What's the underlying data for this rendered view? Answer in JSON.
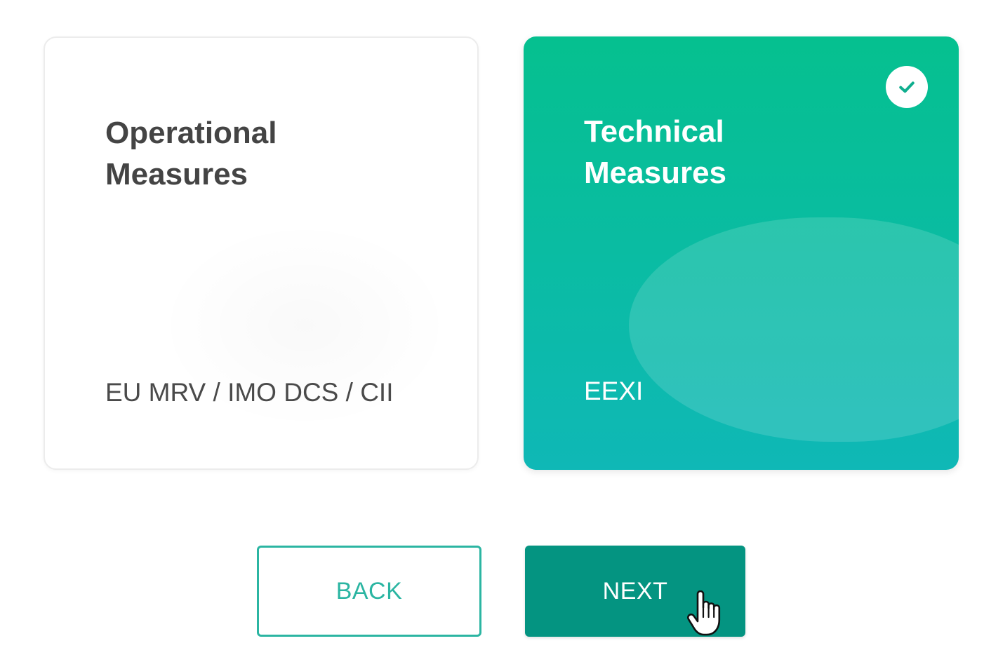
{
  "cards": [
    {
      "title_line1": "Operational",
      "title_line2": "Measures",
      "subtitle": "EU MRV / IMO DCS / CII",
      "selected": false
    },
    {
      "title_line1": "Technical",
      "title_line2": "Measures",
      "subtitle": "EEXI",
      "selected": true
    }
  ],
  "buttons": {
    "back_label": "BACK",
    "next_label": "NEXT"
  },
  "colors": {
    "accent": "#049481",
    "selected_gradient_top": "#05c08f",
    "selected_gradient_bottom": "#0fb8b6",
    "outline": "#2bb5a2"
  },
  "icons": {
    "selected_marker": "check-circle-icon",
    "pointer": "hand-pointer-cursor-icon"
  }
}
